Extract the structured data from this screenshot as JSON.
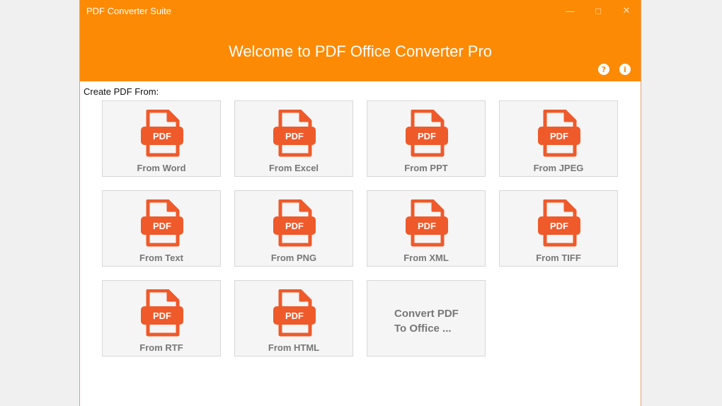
{
  "window": {
    "app_title": "PDF Converter Suite",
    "controls": [
      "minimize-icon",
      "maximize-icon",
      "close-icon"
    ]
  },
  "header": {
    "welcome": "Welcome to PDF Office Converter Pro",
    "icons": [
      "help-icon",
      "info-icon"
    ]
  },
  "main": {
    "create_label": "Create PDF From:",
    "pdf_badge": "PDF",
    "tiles": [
      {
        "label": "From Word"
      },
      {
        "label": "From Excel"
      },
      {
        "label": "From PPT"
      },
      {
        "label": "From JPEG"
      },
      {
        "label": "From Text"
      },
      {
        "label": "From PNG"
      },
      {
        "label": "From XML"
      },
      {
        "label": "From TIFF"
      },
      {
        "label": "From RTF"
      },
      {
        "label": "From HTML"
      }
    ],
    "convert_tile": {
      "line1": "Convert PDF",
      "line2": "To Office ..."
    }
  },
  "colors": {
    "header_orange": "#fd8a05",
    "icon_orange": "#ef5a2b",
    "icon_orange_dark": "#d04a20"
  }
}
